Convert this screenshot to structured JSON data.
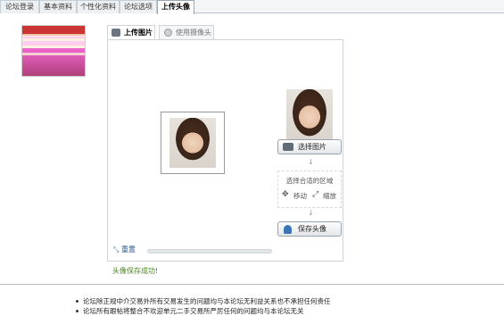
{
  "tabs": [
    {
      "label": "论坛登录",
      "active": false
    },
    {
      "label": "基本资料",
      "active": false
    },
    {
      "label": "个性化资料",
      "active": false
    },
    {
      "label": "论坛选项",
      "active": false
    },
    {
      "label": "上传头像",
      "active": true
    }
  ],
  "upload_tabs": {
    "upload_label": "上传图片",
    "camera_label": "使用摄像头"
  },
  "buttons": {
    "select_image": "选择图片",
    "save_avatar": "保存头像",
    "reset": "重置"
  },
  "hint": {
    "title": "选择合适的区域",
    "move": "移动",
    "zoom": "缩放"
  },
  "status": "头像保存成功!",
  "notes": [
    "论坛除正规中介交易外所有交易发生的问题均与本论坛无利益关系也不承担任何责任",
    "论坛所有跟帖将整合不欢迎单元二手交易所严厉任何的问题均与本论坛无关"
  ],
  "icons": [
    "image-icon",
    "camera-icon",
    "user-icon",
    "move-icon",
    "zoom-icon",
    "reset-icon"
  ],
  "colors": {
    "status": "#4a8a1a",
    "accent": "#3c74b8"
  }
}
